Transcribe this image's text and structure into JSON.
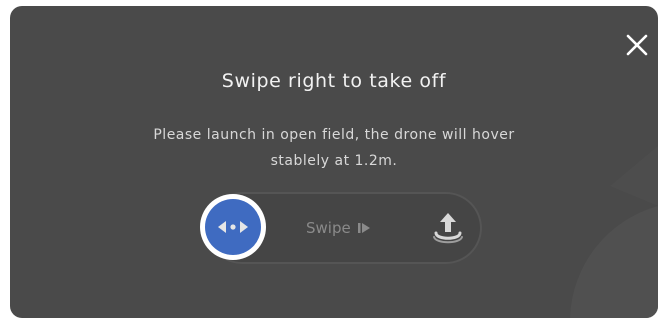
{
  "dialog": {
    "title": "Swipe right to take off",
    "message_line1": "Please launch in open field, the drone will hover",
    "message_line2": "stablely at 1.2m.",
    "close_icon": "close-icon"
  },
  "slider": {
    "hint_label": "Swipe",
    "hint_icon": "play-arrow-icon",
    "knob_icon": "drag-arrows-icon",
    "target_icon": "takeoff-icon",
    "progress": 0
  },
  "colors": {
    "dialog_bg": "#4a4a4a",
    "accent": "#3f6bc1",
    "title_text": "#f2f2f2",
    "hint_text": "#8a8a8a"
  }
}
